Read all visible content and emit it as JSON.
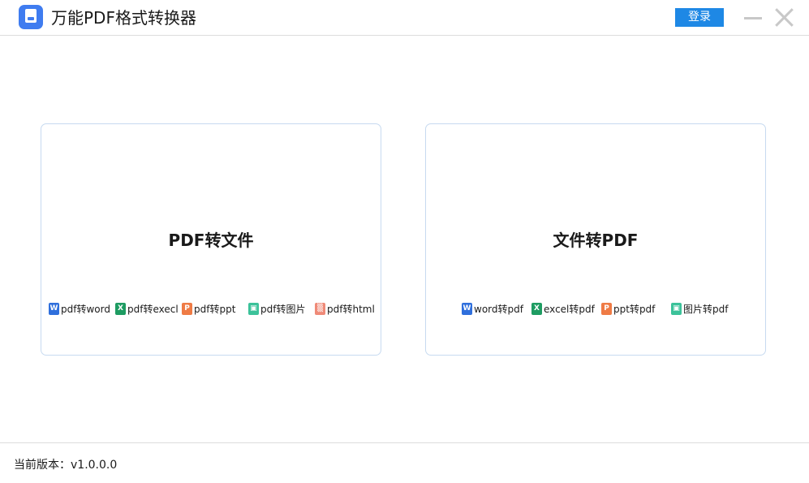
{
  "window": {
    "title": "万能PDF格式转换器",
    "login_label": "登录"
  },
  "cards": {
    "pdf_to_file": {
      "title": "PDF转文件",
      "formats": [
        {
          "label": "pdf转word",
          "icon": "word-file-icon",
          "glyph": "W"
        },
        {
          "label": "pdf转execl",
          "icon": "excel-file-icon",
          "glyph": "X"
        },
        {
          "label": "pdf转ppt",
          "icon": "ppt-file-icon",
          "glyph": "P"
        },
        {
          "label": "pdf转图片",
          "icon": "image-file-icon",
          "glyph": "▣"
        },
        {
          "label": "pdf转html",
          "icon": "html-file-icon",
          "glyph": "▒"
        }
      ]
    },
    "file_to_pdf": {
      "title": "文件转PDF",
      "formats": [
        {
          "label": "word转pdf",
          "icon": "word-file-icon",
          "glyph": "W"
        },
        {
          "label": "excel转pdf",
          "icon": "excel-file-icon",
          "glyph": "X"
        },
        {
          "label": "ppt转pdf",
          "icon": "ppt-file-icon",
          "glyph": "P"
        },
        {
          "label": "图片转pdf",
          "icon": "image-file-icon",
          "glyph": "▣"
        }
      ]
    }
  },
  "footer": {
    "version_text": "当前版本：v1.0.0.0"
  },
  "colors": {
    "accent": "#1e88e5",
    "card_border": "#c7daf0",
    "word": "#2f6fdc",
    "excel": "#1e9c62",
    "ppt": "#ef7b45",
    "image": "#3cc29a",
    "html": "#ef8a78"
  }
}
